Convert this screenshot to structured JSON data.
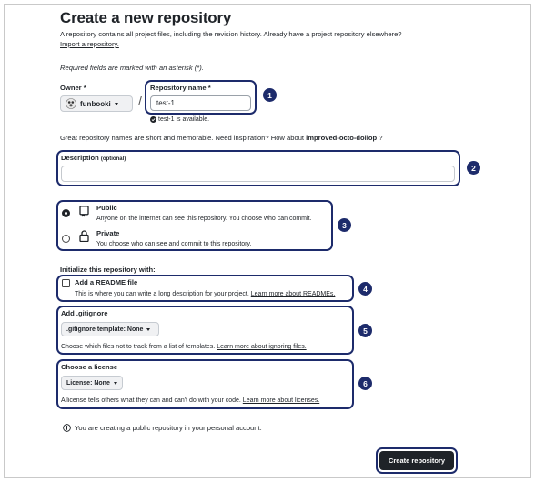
{
  "page": {
    "title": "Create a new repository",
    "intro": "A repository contains all project files, including the revision history. Already have a project repository elsewhere?",
    "import_link": "Import a repository.",
    "required_note": "Required fields are marked with an asterisk (*)."
  },
  "owner": {
    "label": "Owner *",
    "value": "funbooki"
  },
  "separator": "/",
  "repo_name": {
    "label": "Repository name *",
    "value": "test-1",
    "availability": "test-1 is available."
  },
  "suggestion": {
    "prefix": "Great repository names are short and memorable. Need inspiration? How about ",
    "name": "improved-octo-dollop",
    "suffix": " ?"
  },
  "description": {
    "label": "Description",
    "optional": "(optional)",
    "value": ""
  },
  "visibility": {
    "public_label": "Public",
    "public_desc": "Anyone on the internet can see this repository. You choose who can commit.",
    "private_label": "Private",
    "private_desc": "You choose who can see and commit to this repository.",
    "selected": "Public"
  },
  "initialize": {
    "heading": "Initialize this repository with:",
    "readme_label": "Add a README file",
    "readme_desc": "This is where you can write a long description for your project.",
    "readme_link": "Learn more about READMEs.",
    "readme_checked": false
  },
  "gitignore": {
    "heading": "Add .gitignore",
    "select": ".gitignore template: None",
    "desc": "Choose which files not to track from a list of templates.",
    "link": "Learn more about ignoring files."
  },
  "license": {
    "heading": "Choose a license",
    "select": "License: None",
    "desc": "A license tells others what they can and can't do with your code.",
    "link": "Learn more about licenses."
  },
  "info": "You are creating a public repository in your personal account.",
  "create_button": "Create repository",
  "callouts": [
    "1",
    "2",
    "3",
    "4",
    "5",
    "6"
  ],
  "colors": {
    "callout": "#1d2b6b",
    "primary_button": "#1f2328",
    "available": "#1a7f37"
  },
  "icons": [
    "avatar-icon",
    "chevron-down-icon",
    "check-circle-icon",
    "repo-icon",
    "lock-icon",
    "info-icon"
  ]
}
